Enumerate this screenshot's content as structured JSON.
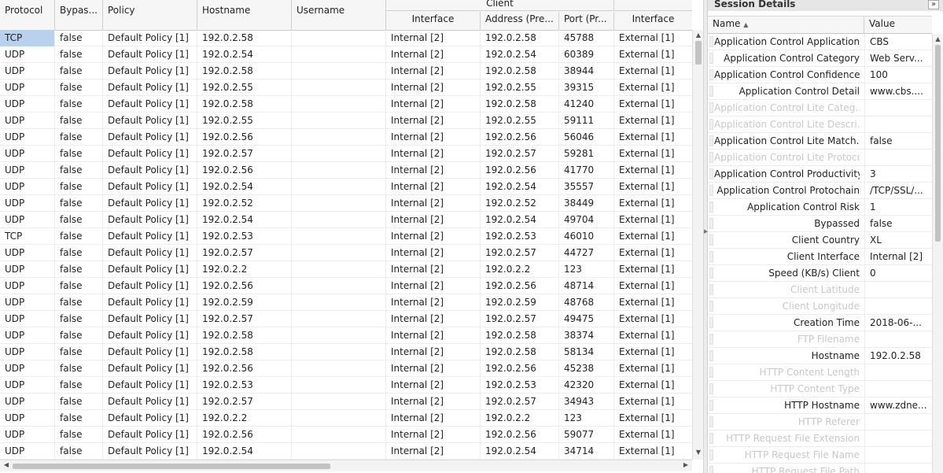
{
  "grid": {
    "columns": {
      "protocol": "Protocol",
      "bypassed": "Bypas...",
      "policy": "Policy",
      "hostname": "Hostname",
      "username": "Username"
    },
    "client_group": "Client",
    "client_columns": {
      "interface": "Interface",
      "address": "Address (Pre...",
      "port": "Port (Pr..."
    },
    "server_columns": {
      "interface": "Interface"
    },
    "rows": [
      [
        "TCP",
        "false",
        "Default Policy [1]",
        "192.0.2.58",
        "",
        "Internal [2]",
        "192.0.2.58",
        "45788",
        "External [1]"
      ],
      [
        "UDP",
        "false",
        "Default Policy [1]",
        "192.0.2.54",
        "",
        "Internal [2]",
        "192.0.2.54",
        "60389",
        "External [1]"
      ],
      [
        "UDP",
        "false",
        "Default Policy [1]",
        "192.0.2.58",
        "",
        "Internal [2]",
        "192.0.2.58",
        "38944",
        "External [1]"
      ],
      [
        "UDP",
        "false",
        "Default Policy [1]",
        "192.0.2.55",
        "",
        "Internal [2]",
        "192.0.2.55",
        "39315",
        "External [1]"
      ],
      [
        "UDP",
        "false",
        "Default Policy [1]",
        "192.0.2.58",
        "",
        "Internal [2]",
        "192.0.2.58",
        "41240",
        "External [1]"
      ],
      [
        "UDP",
        "false",
        "Default Policy [1]",
        "192.0.2.55",
        "",
        "Internal [2]",
        "192.0.2.55",
        "59111",
        "External [1]"
      ],
      [
        "UDP",
        "false",
        "Default Policy [1]",
        "192.0.2.56",
        "",
        "Internal [2]",
        "192.0.2.56",
        "56046",
        "External [1]"
      ],
      [
        "UDP",
        "false",
        "Default Policy [1]",
        "192.0.2.57",
        "",
        "Internal [2]",
        "192.0.2.57",
        "59281",
        "External [1]"
      ],
      [
        "UDP",
        "false",
        "Default Policy [1]",
        "192.0.2.56",
        "",
        "Internal [2]",
        "192.0.2.56",
        "41770",
        "External [1]"
      ],
      [
        "UDP",
        "false",
        "Default Policy [1]",
        "192.0.2.54",
        "",
        "Internal [2]",
        "192.0.2.54",
        "35557",
        "External [1]"
      ],
      [
        "UDP",
        "false",
        "Default Policy [1]",
        "192.0.2.52",
        "",
        "Internal [2]",
        "192.0.2.52",
        "38449",
        "External [1]"
      ],
      [
        "UDP",
        "false",
        "Default Policy [1]",
        "192.0.2.54",
        "",
        "Internal [2]",
        "192.0.2.54",
        "49704",
        "External [1]"
      ],
      [
        "TCP",
        "false",
        "Default Policy [1]",
        "192.0.2.53",
        "",
        "Internal [2]",
        "192.0.2.53",
        "46010",
        "External [1]"
      ],
      [
        "UDP",
        "false",
        "Default Policy [1]",
        "192.0.2.57",
        "",
        "Internal [2]",
        "192.0.2.57",
        "44727",
        "External [1]"
      ],
      [
        "UDP",
        "false",
        "Default Policy [1]",
        "192.0.2.2",
        "",
        "Internal [2]",
        "192.0.2.2",
        "123",
        "External [1]"
      ],
      [
        "UDP",
        "false",
        "Default Policy [1]",
        "192.0.2.56",
        "",
        "Internal [2]",
        "192.0.2.56",
        "48714",
        "External [1]"
      ],
      [
        "UDP",
        "false",
        "Default Policy [1]",
        "192.0.2.59",
        "",
        "Internal [2]",
        "192.0.2.59",
        "48768",
        "External [1]"
      ],
      [
        "UDP",
        "false",
        "Default Policy [1]",
        "192.0.2.57",
        "",
        "Internal [2]",
        "192.0.2.57",
        "49475",
        "External [1]"
      ],
      [
        "UDP",
        "false",
        "Default Policy [1]",
        "192.0.2.58",
        "",
        "Internal [2]",
        "192.0.2.58",
        "38374",
        "External [1]"
      ],
      [
        "UDP",
        "false",
        "Default Policy [1]",
        "192.0.2.58",
        "",
        "Internal [2]",
        "192.0.2.58",
        "58134",
        "External [1]"
      ],
      [
        "UDP",
        "false",
        "Default Policy [1]",
        "192.0.2.56",
        "",
        "Internal [2]",
        "192.0.2.56",
        "45238",
        "External [1]"
      ],
      [
        "UDP",
        "false",
        "Default Policy [1]",
        "192.0.2.53",
        "",
        "Internal [2]",
        "192.0.2.53",
        "42320",
        "External [1]"
      ],
      [
        "UDP",
        "false",
        "Default Policy [1]",
        "192.0.2.57",
        "",
        "Internal [2]",
        "192.0.2.57",
        "34943",
        "External [1]"
      ],
      [
        "UDP",
        "false",
        "Default Policy [1]",
        "192.0.2.2",
        "",
        "Internal [2]",
        "192.0.2.2",
        "123",
        "External [1]"
      ],
      [
        "UDP",
        "false",
        "Default Policy [1]",
        "192.0.2.56",
        "",
        "Internal [2]",
        "192.0.2.56",
        "59077",
        "External [1]"
      ],
      [
        "UDP",
        "false",
        "Default Policy [1]",
        "192.0.2.54",
        "",
        "Internal [2]",
        "192.0.2.54",
        "34714",
        "External [1]"
      ]
    ],
    "selected_row": 0,
    "selection_color": "#b9d1ea"
  },
  "details": {
    "title": "Session Details",
    "collapse_icon": "double-chevron-right-icon",
    "collapse_glyph": "»",
    "header_name": "Name",
    "sort_glyph": "▲",
    "header_value": "Value",
    "rows": [
      {
        "name": "Application Control Application",
        "value": "CBS",
        "dim": false
      },
      {
        "name": "Application Control Category",
        "value": "Web Serv...",
        "dim": false
      },
      {
        "name": "Application Control Confidence",
        "value": "100",
        "dim": false
      },
      {
        "name": "Application Control Detail",
        "value": "www.cbs....",
        "dim": false
      },
      {
        "name": "Application Control Lite Categ...",
        "value": "",
        "dim": true
      },
      {
        "name": "Application Control Lite Descri...",
        "value": "",
        "dim": true
      },
      {
        "name": "Application Control Lite Match...",
        "value": "false",
        "dim": false
      },
      {
        "name": "Application Control Lite Protocol",
        "value": "",
        "dim": true
      },
      {
        "name": "Application Control Productivity",
        "value": "3",
        "dim": false
      },
      {
        "name": "Application Control Protochain",
        "value": "/TCP/SSL/...",
        "dim": false
      },
      {
        "name": "Application Control Risk",
        "value": "1",
        "dim": false
      },
      {
        "name": "Bypassed",
        "value": "false",
        "dim": false
      },
      {
        "name": "Client Country",
        "value": "XL",
        "dim": false
      },
      {
        "name": "Client Interface",
        "value": "Internal [2]",
        "dim": false
      },
      {
        "name": "Speed (KB/s) Client",
        "value": "0",
        "dim": false
      },
      {
        "name": "Client Latitude",
        "value": "",
        "dim": true
      },
      {
        "name": "Client Longitude",
        "value": "",
        "dim": true
      },
      {
        "name": "Creation Time",
        "value": "2018-06-...",
        "dim": false
      },
      {
        "name": "FTP Filename",
        "value": "",
        "dim": true
      },
      {
        "name": "Hostname",
        "value": "192.0.2.58",
        "dim": false
      },
      {
        "name": "HTTP Content Length",
        "value": "",
        "dim": true
      },
      {
        "name": "HTTP Content Type",
        "value": "",
        "dim": true
      },
      {
        "name": "HTTP Hostname",
        "value": "www.zdne...",
        "dim": false
      },
      {
        "name": "HTTP Referer",
        "value": "",
        "dim": true
      },
      {
        "name": "HTTP Request File Extension",
        "value": "",
        "dim": true
      },
      {
        "name": "HTTP Request File Name",
        "value": "",
        "dim": true
      },
      {
        "name": "HTTP Request File Path",
        "value": "",
        "dim": true
      }
    ]
  }
}
